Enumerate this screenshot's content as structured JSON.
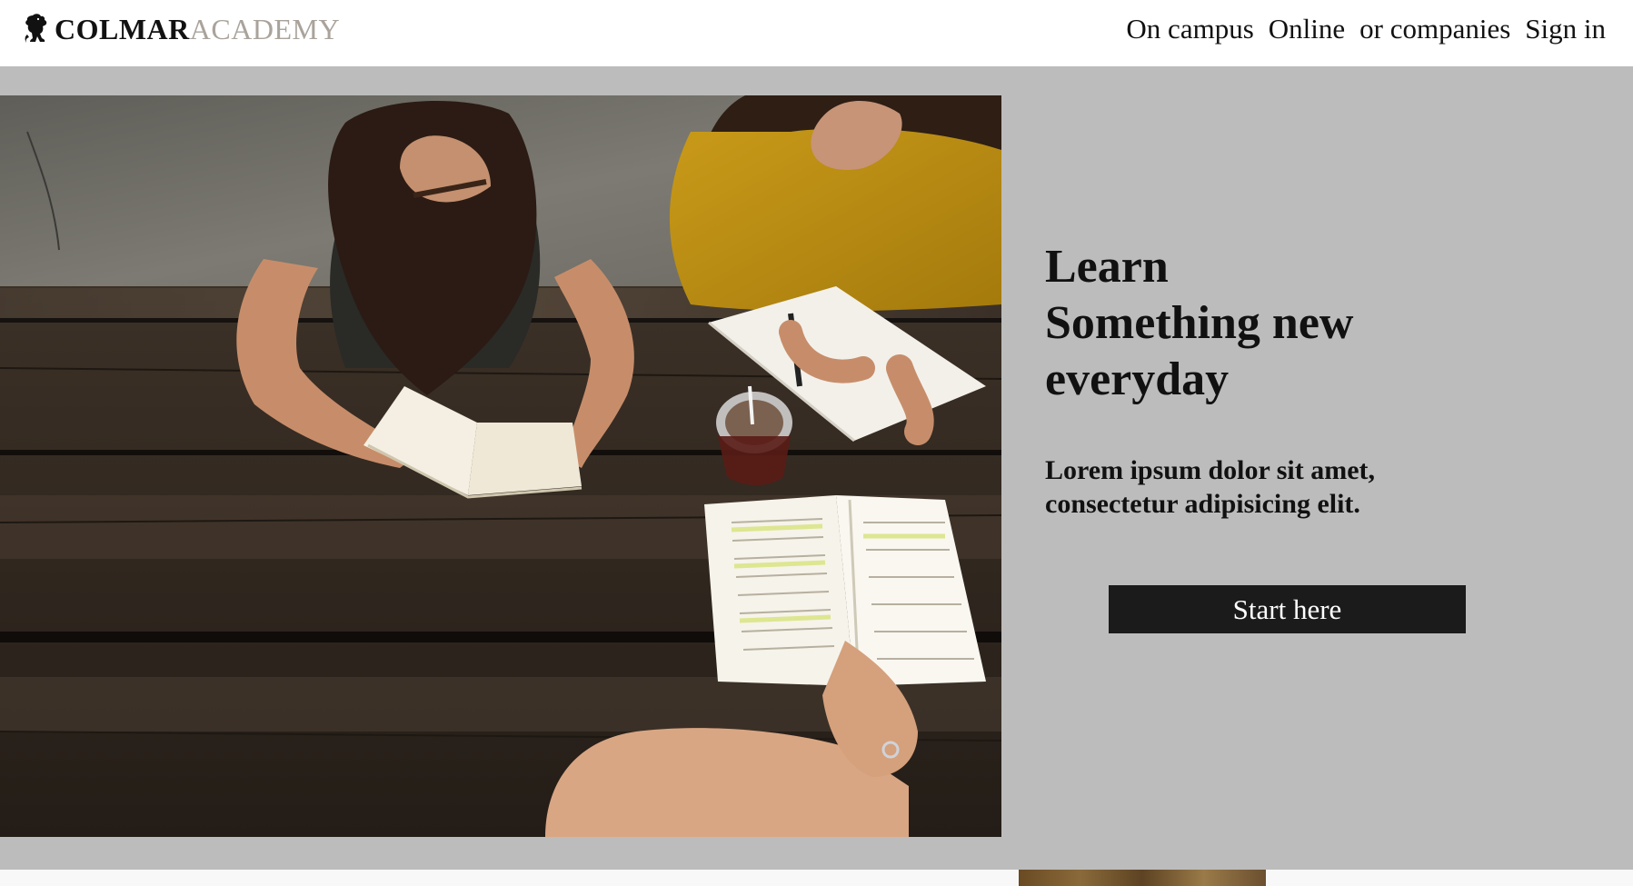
{
  "header": {
    "logo_bold": "COLMAR",
    "logo_light": "ACADEMY",
    "logo_icon": "lion-rampant-icon",
    "nav": [
      {
        "label": "On campus"
      },
      {
        "label": "Online"
      },
      {
        "label": "or companies"
      },
      {
        "label": "Sign in"
      }
    ]
  },
  "hero": {
    "headline_line1": "Learn",
    "headline_line2": "Something new",
    "headline_line3": "everyday",
    "subtext_line1": "Lorem ipsum dolor sit amet,",
    "subtext_line2": "consectetur adipisicing elit.",
    "cta_label": "Start here",
    "image_subject": "students-reading-at-picnic-table"
  },
  "colors": {
    "hero_background": "#bcbcbc",
    "cta_background": "#1b1b1b",
    "logo_light": "#a9a39b",
    "text": "#111111"
  }
}
